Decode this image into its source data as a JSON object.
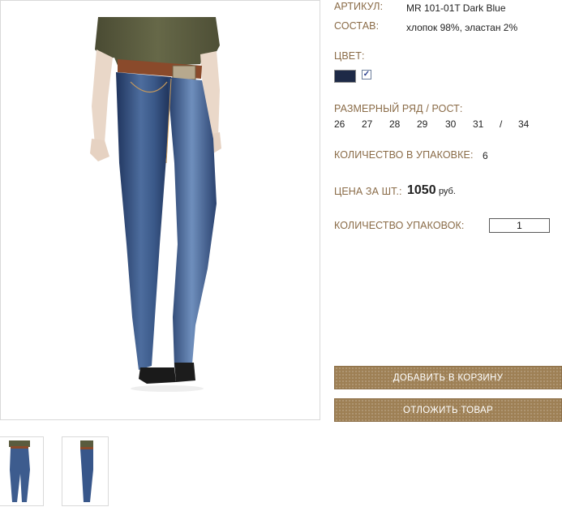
{
  "product": {
    "article_label": "АРТИКУЛ:",
    "article_value": "MR 101-01T Dark Blue",
    "composition_label": "СОСТАВ:",
    "composition_value": "хлопок 98%, эластан 2%",
    "color_label": "ЦВЕТ:",
    "color_swatch": "#1e2a47",
    "color_checked": true,
    "sizes_label": "РАЗМЕРНЫЙ РЯД / РОСТ:",
    "sizes": [
      "26",
      "27",
      "28",
      "29",
      "30",
      "31",
      "/",
      "34"
    ],
    "pack_qty_label": "КОЛИЧЕСТВО В УПАКОВКЕ:",
    "pack_qty_value": "6",
    "price_label": "ЦЕНА ЗА ШТ.:",
    "price_value": "1050",
    "price_currency": "руб.",
    "packs_label": "КОЛИЧЕСТВО УПАКОВОК:",
    "packs_value": "1"
  },
  "buttons": {
    "add_to_cart": "ДОБАВИТЬ В КОРЗИНУ",
    "save_item": "ОТЛОЖИТЬ ТОВАР"
  },
  "colors": {
    "label": "#8a6b47",
    "button": "#9e8055",
    "denim": "#34507e"
  },
  "images": {
    "main": "jeans-front-photo",
    "thumbnails": [
      "jeans-front-thumb",
      "jeans-side-thumb"
    ]
  }
}
